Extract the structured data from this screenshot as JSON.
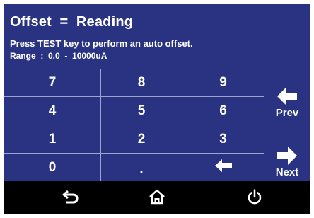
{
  "header": {
    "title": "Offset  =  Reading",
    "instruction": "Press  TEST  key to perform an auto offset.",
    "range": "Range  :  0.0  -  10000uA"
  },
  "keypad": {
    "keys": [
      "7",
      "8",
      "9",
      "4",
      "5",
      "6",
      "1",
      "2",
      "3",
      "0",
      "."
    ],
    "prev_label": "Prev",
    "next_label": "Next"
  },
  "icons": {
    "backspace": "left-arrow-icon",
    "prev": "left-arrow-icon",
    "next": "right-arrow-icon",
    "back": "return-arrow-icon",
    "home": "home-icon",
    "power": "power-icon"
  },
  "colors": {
    "panel": "#2a3382",
    "grid_lines": "#9ea3d0",
    "background": "#000000",
    "text": "#ffffff"
  }
}
